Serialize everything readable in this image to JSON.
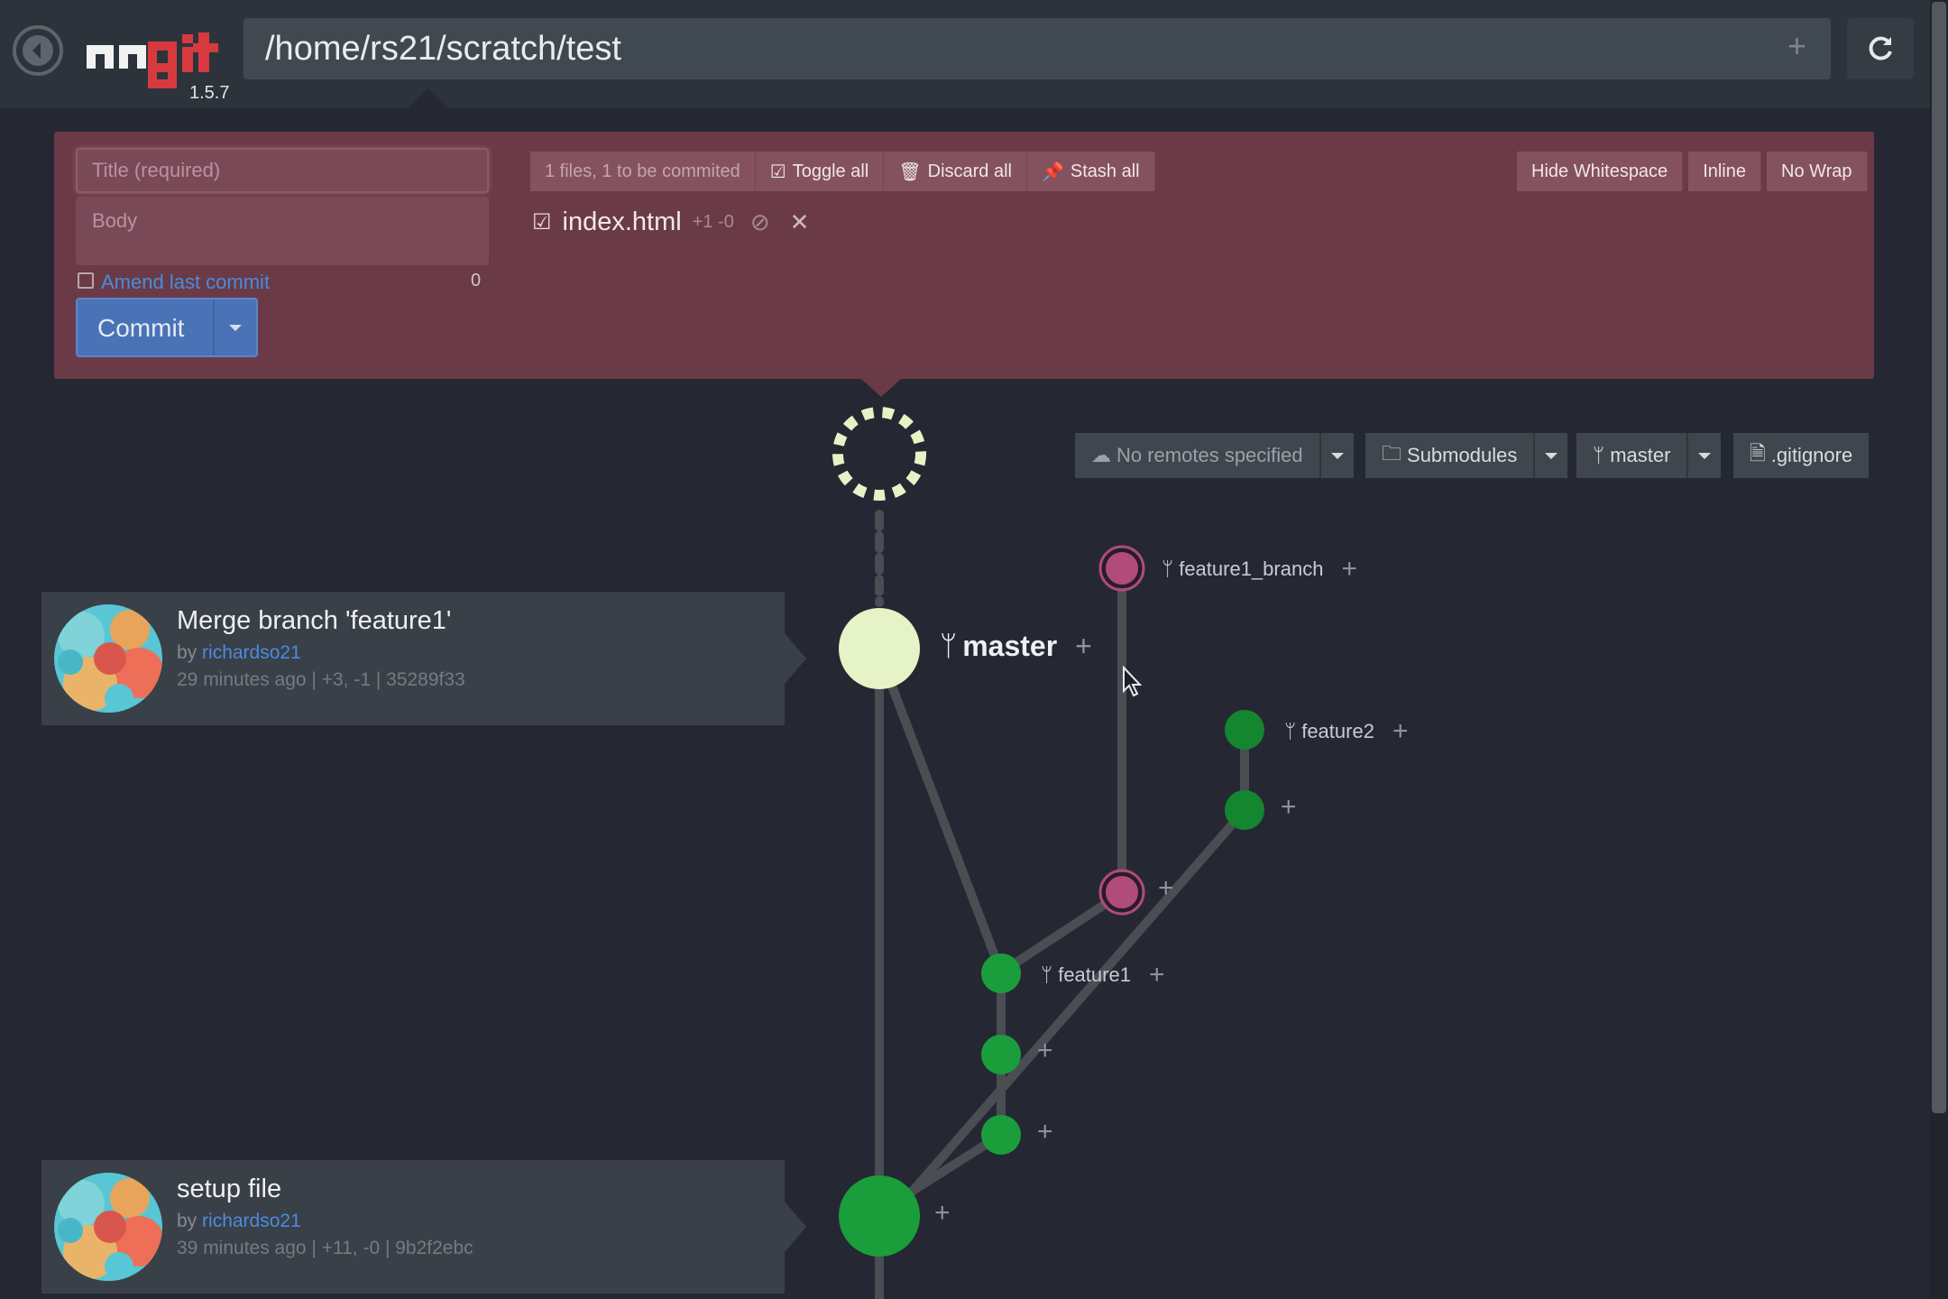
{
  "app": {
    "path": "/home/rs21/scratch/test",
    "version": "1.5.7",
    "logo_text": "ungit"
  },
  "staging": {
    "title_placeholder": "Title (required)",
    "body_placeholder": "Body",
    "amend_label": "Amend last commit",
    "char_count": "0",
    "commit_label": "Commit",
    "summary": "1 files, 1 to be commited",
    "toggle_all": "Toggle all",
    "discard_all": "Discard all",
    "stash_all": "Stash all",
    "hide_whitespace": "Hide Whitespace",
    "inline": "Inline",
    "no_wrap": "No Wrap",
    "file": {
      "name": "index.html",
      "diff": "+1 -0"
    }
  },
  "repo_toolbar": {
    "remotes": "No remotes specified",
    "submodules": "Submodules",
    "branch": "master",
    "gitignore": ".gitignore"
  },
  "commits": [
    {
      "title": "Merge branch 'feature1'",
      "by": "by",
      "author": "richardso21",
      "meta": "29 minutes ago | +3, -1 | 35289f33"
    },
    {
      "title": "setup file",
      "by": "by",
      "author": "richardso21",
      "meta": "39 minutes ago | +11, -0 | 9b2f2ebc"
    }
  ],
  "refs": {
    "feature1_branch": "feature1_branch",
    "master": "master",
    "feature2": "feature2",
    "feature1": "feature1"
  },
  "colors": {
    "staging_bg": "#6a3b47",
    "master_node": "#e6f3c6",
    "green_node": "#1a9e3c",
    "pink_node": "#b04b7a",
    "link": "#4a8bdd",
    "commit_button": "#4a72b6"
  },
  "icons": {
    "back": "arrow-left-circle",
    "refresh": "refresh",
    "branch": "code-fork",
    "cloud": "cloud-upload",
    "folder": "folder",
    "file": "file-text",
    "check": "check-square",
    "trash": "trash",
    "pin": "thumbtack",
    "ban": "ban",
    "close": "times"
  }
}
